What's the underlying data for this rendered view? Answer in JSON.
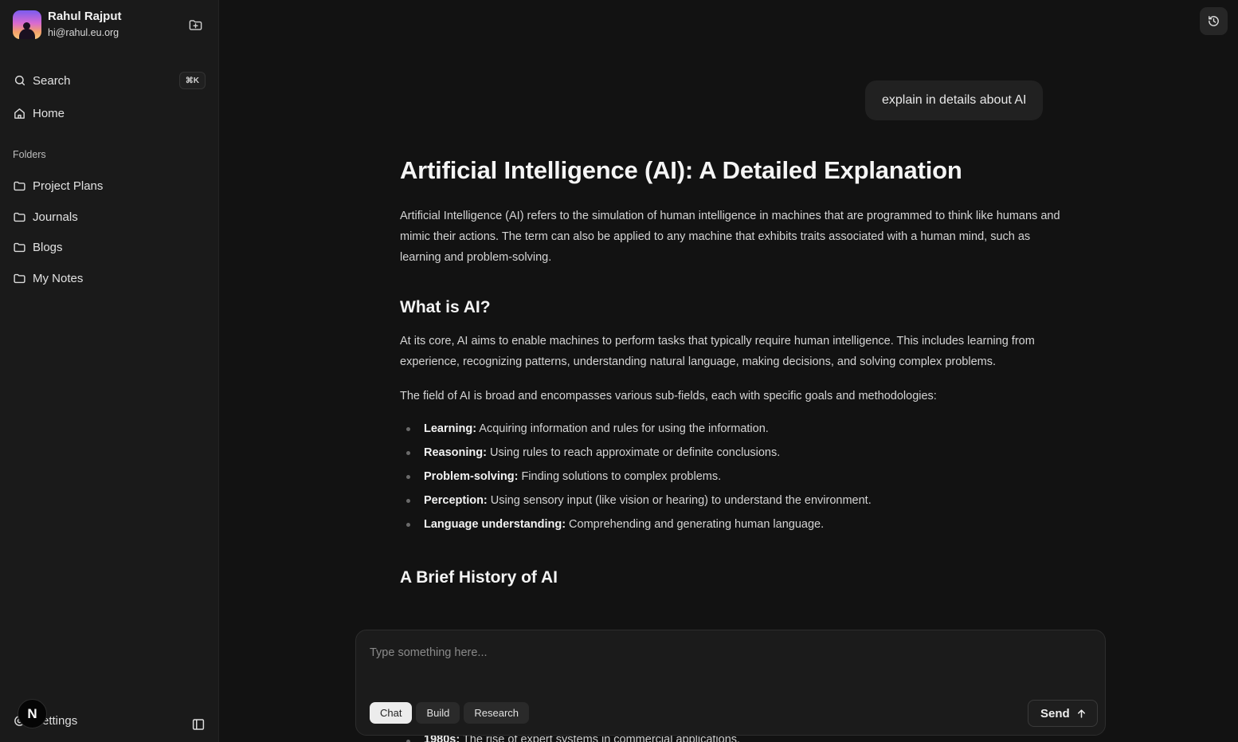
{
  "user": {
    "name": "Rahul Rajput",
    "email": "hi@rahul.eu.org"
  },
  "sidebar": {
    "search_label": "Search",
    "search_shortcut": "⌘K",
    "home_label": "Home",
    "folders_title": "Folders",
    "folders": [
      "Project Plans",
      "Journals",
      "Blogs",
      "My Notes"
    ],
    "settings_label": "Settings",
    "badge_letter": "N"
  },
  "chat": {
    "user_message": "explain in details about AI",
    "title": "Artificial Intelligence (AI): A Detailed Explanation",
    "intro": "Artificial Intelligence (AI) refers to the simulation of human intelligence in machines that are programmed to think like humans and mimic their actions. The term can also be applied to any machine that exhibits traits associated with a human mind, such as learning and problem-solving.",
    "section1_title": "What is AI?",
    "section1_p1": "At its core, AI aims to enable machines to perform tasks that typically require human intelligence. This includes learning from experience, recognizing patterns, understanding natural language, making decisions, and solving complex problems.",
    "section1_p2": "The field of AI is broad and encompasses various sub-fields, each with specific goals and methodologies:",
    "bullets": [
      {
        "term": "Learning:",
        "text": " Acquiring information and rules for using the information."
      },
      {
        "term": "Reasoning:",
        "text": " Using rules to reach approximate or definite conclusions."
      },
      {
        "term": "Problem-solving:",
        "text": " Finding solutions to complex problems."
      },
      {
        "term": "Perception:",
        "text": " Using sensory input (like vision or hearing) to understand the environment."
      },
      {
        "term": "Language understanding:",
        "text": " Comprehending and generating human language."
      }
    ],
    "section2_title": "A Brief History of AI",
    "clipped_item": {
      "term": "1980s:",
      "text": " The rise of expert systems in commercial applications."
    }
  },
  "composer": {
    "placeholder": "Type something here...",
    "modes": [
      "Chat",
      "Build",
      "Research"
    ],
    "active_mode": "Chat",
    "send_label": "Send"
  },
  "icons": {
    "new_folder": "folder-plus-icon",
    "search": "search-icon",
    "home": "home-icon",
    "folder": "folder-icon",
    "settings": "settings-icon",
    "sidebar_toggle": "panel-left-icon",
    "history": "history-icon",
    "send": "arrow-up-icon"
  }
}
